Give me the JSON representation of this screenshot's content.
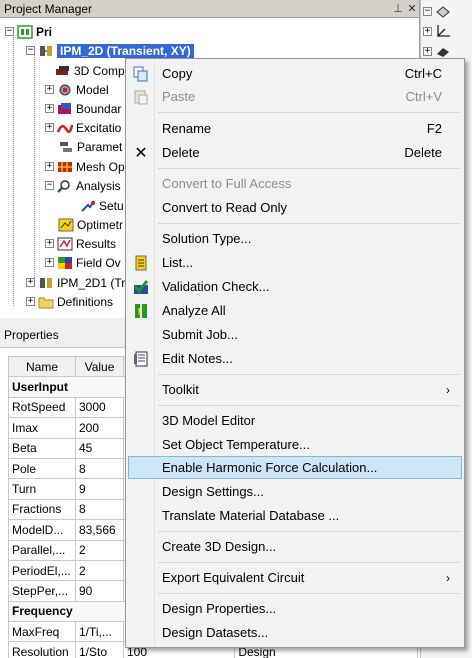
{
  "project_manager": {
    "title": "Project Manager",
    "pin_icon": "pin-icon",
    "close_icon": "close-icon",
    "root": "Pri",
    "design": "IPM_2D (Transient, XY)",
    "children": [
      "3D Comp",
      "Model",
      "Boundar",
      "Excitatio",
      "Paramet",
      "Mesh Op",
      "Analysis",
      "Setu",
      "Optimetr",
      "Results",
      "Field Ov"
    ],
    "design2": "IPM_2D1 (Tr",
    "definitions": "Definitions"
  },
  "properties": {
    "title": "Properties",
    "headers": [
      "Name",
      "Value"
    ],
    "rows": [
      {
        "group": "UserInput"
      },
      {
        "name": "RotSpeed",
        "value": "3000"
      },
      {
        "name": "Imax",
        "value": "200"
      },
      {
        "name": "Beta",
        "value": "45"
      },
      {
        "name": "Pole",
        "value": "8"
      },
      {
        "name": "Turn",
        "value": "9"
      },
      {
        "name": "Fractions",
        "value": "8"
      },
      {
        "name": "ModelD...",
        "value": "83,566"
      },
      {
        "name": "Parallel,...",
        "value": "2"
      },
      {
        "name": "PeriodEl,...",
        "value": "2"
      },
      {
        "name": "StepPer,...",
        "value": "90"
      },
      {
        "group": "Frequency"
      },
      {
        "name": "MaxFreq",
        "value": "1/Ti,..."
      },
      {
        "name": "Resolution",
        "value": "1/Sto"
      }
    ],
    "partial_cells": [
      "100",
      "Design"
    ]
  },
  "menu": {
    "items": [
      {
        "label": "Copy",
        "shortcut": "Ctrl+C",
        "icon": "copy-icon",
        "disabled": false
      },
      {
        "label": "Paste",
        "shortcut": "Ctrl+V",
        "icon": "paste-icon",
        "disabled": true
      },
      {
        "label": "Rename",
        "shortcut": "F2",
        "disabled": false
      },
      {
        "label": "Delete",
        "shortcut": "Delete",
        "icon": "delete-x-icon",
        "disabled": false
      },
      {
        "label": "Convert to Full Access",
        "disabled": true
      },
      {
        "label": "Convert to Read Only",
        "disabled": false
      },
      {
        "label": "Solution Type...",
        "disabled": false
      },
      {
        "label": "List...",
        "icon": "list-icon",
        "disabled": false
      },
      {
        "label": "Validation Check...",
        "icon": "validation-check-icon",
        "disabled": false
      },
      {
        "label": "Analyze All",
        "icon": "analyze-icon",
        "disabled": false
      },
      {
        "label": "Submit Job...",
        "disabled": false
      },
      {
        "label": "Edit Notes...",
        "icon": "notes-icon",
        "disabled": false
      },
      {
        "label": "Toolkit",
        "submenu": true,
        "disabled": false
      },
      {
        "label": "3D Model Editor",
        "disabled": false
      },
      {
        "label": "Set Object Temperature...",
        "disabled": false
      },
      {
        "label": "Enable Harmonic Force Calculation...",
        "highlighted": true,
        "disabled": false
      },
      {
        "label": "Design Settings...",
        "disabled": false
      },
      {
        "label": "Translate Material Database ...",
        "disabled": false
      },
      {
        "label": "Create 3D Design...",
        "disabled": false
      },
      {
        "label": "Export Equivalent Circuit",
        "submenu": true,
        "disabled": false
      },
      {
        "label": "Design Properties...",
        "disabled": false
      },
      {
        "label": "Design Datasets...",
        "disabled": false
      }
    ]
  },
  "colors": {
    "selection": "#3369d6",
    "menu_highlight": "#cde6f7",
    "menu_highlight_border": "#7db8e0"
  }
}
